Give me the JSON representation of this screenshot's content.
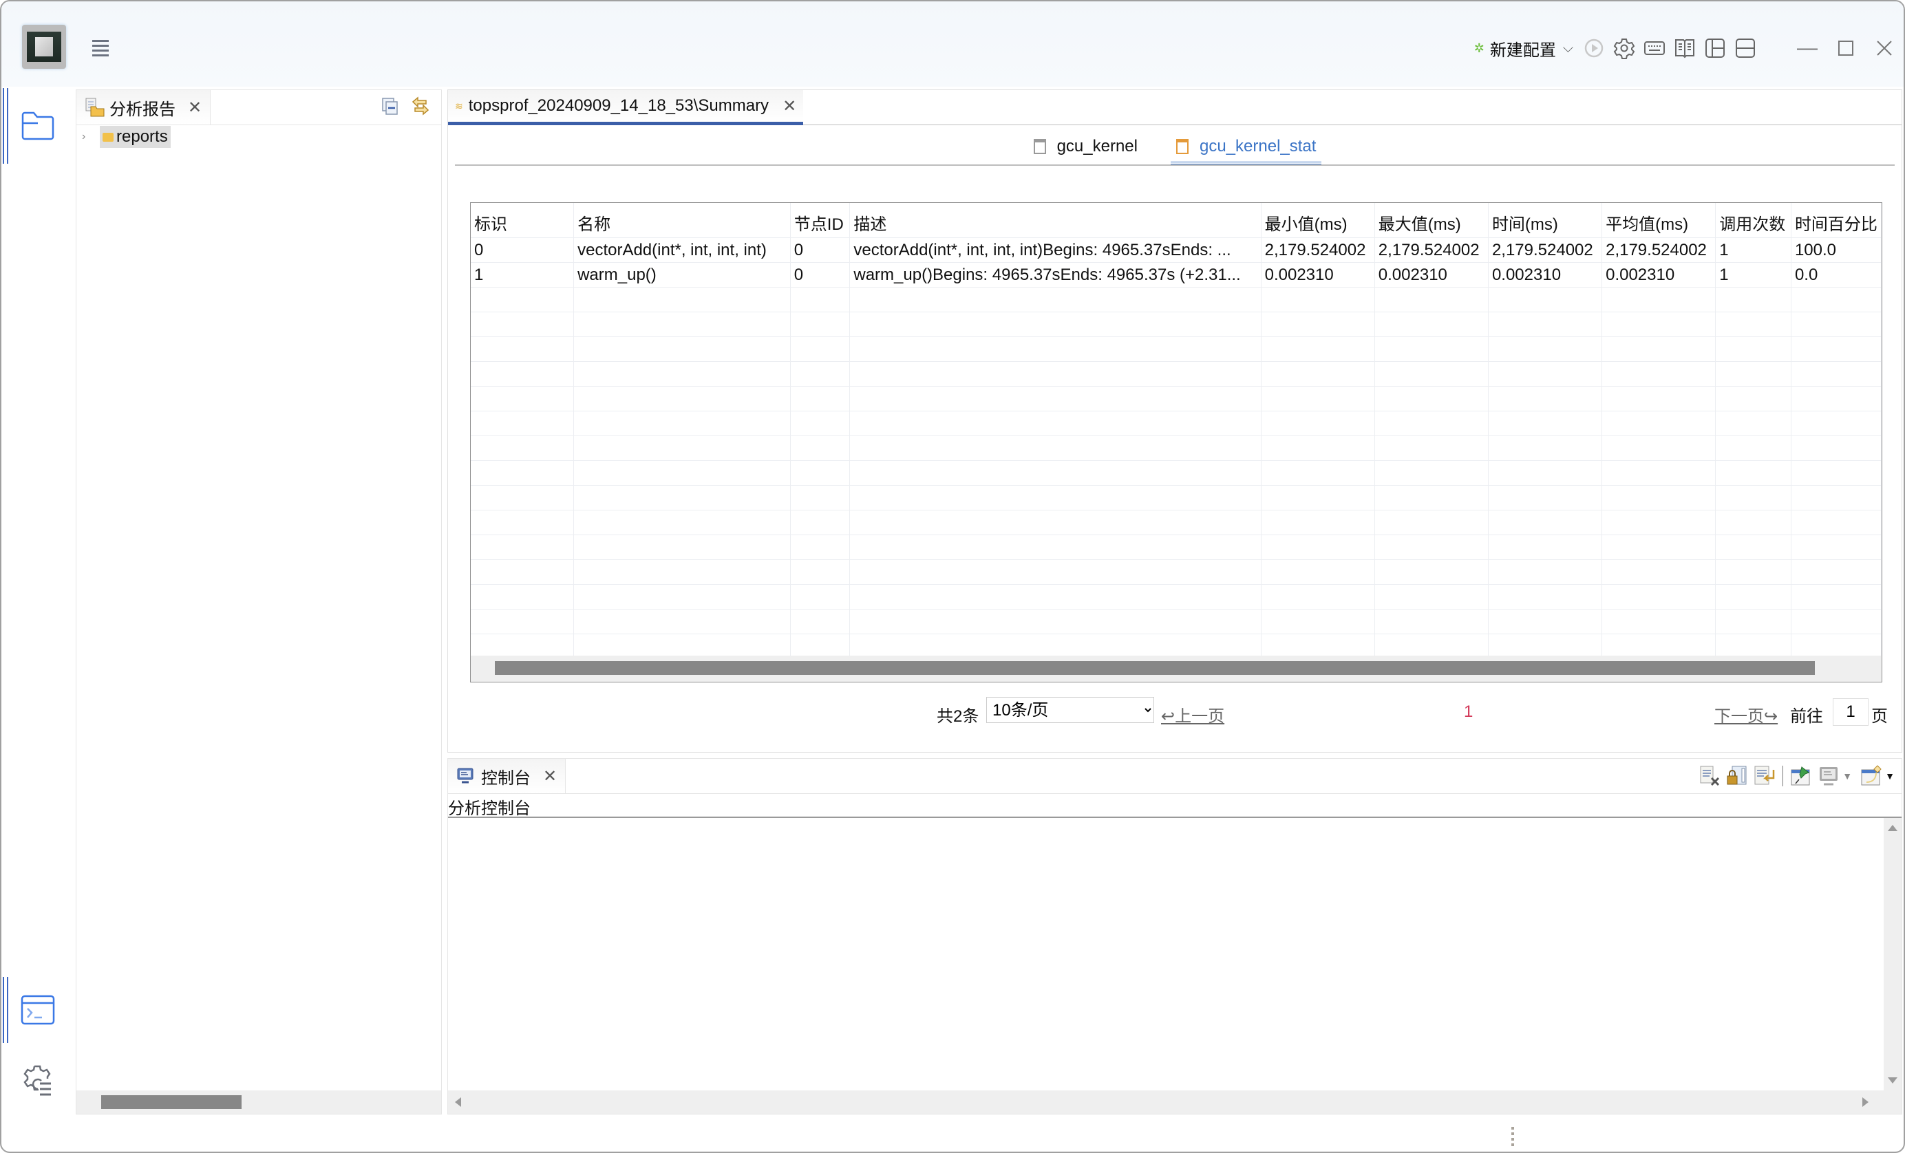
{
  "titlebar": {
    "run_config_label": "新建配置",
    "icons": [
      "run-icon",
      "settings-icon",
      "keyboard-icon",
      "book-icon",
      "layout-left-icon",
      "layout-bottom-icon"
    ],
    "window_controls": [
      "minimize",
      "maximize",
      "close"
    ]
  },
  "activity_bar": {
    "items": [
      {
        "name": "explorer",
        "icon": "folder-icon",
        "active": true
      },
      {
        "name": "terminal",
        "icon": "terminal-icon",
        "active": true
      },
      {
        "name": "settings",
        "icon": "gear-list-icon",
        "active": false
      }
    ]
  },
  "left_panel": {
    "tab_label": "分析报告",
    "tree": [
      {
        "label": "reports",
        "expanded": false
      }
    ]
  },
  "editor": {
    "tab_label": "topsprof_20240909_14_18_53\\Summary",
    "subtabs": [
      {
        "label": "gcu_kernel",
        "active": false
      },
      {
        "label": "gcu_kernel_stat",
        "active": true
      }
    ],
    "table": {
      "columns": [
        "标识",
        "名称",
        "节点ID",
        "描述",
        "最小值(ms)",
        "最大值(ms)",
        "时间(ms)",
        "平均值(ms)",
        "调用次数",
        "时间百分比"
      ],
      "rows": [
        [
          "0",
          "vectorAdd(int*, int, int, int)",
          "0",
          "vectorAdd(int*, int, int, int)Begins: 4965.37sEnds: ...",
          "2,179.524002",
          "2,179.524002",
          "2,179.524002",
          "2,179.524002",
          "1",
          "100.0"
        ],
        [
          "1",
          "warm_up()",
          "0",
          "warm_up()Begins: 4965.37sEnds: 4965.37s (+2.31...",
          "0.002310",
          "0.002310",
          "0.002310",
          "0.002310",
          "1",
          "0.0"
        ]
      ]
    },
    "pager": {
      "total_label": "共2条",
      "page_size": "10条/页",
      "prev_label": "↩上一页",
      "current_page": "1",
      "next_label": "下一页↪",
      "goto_label": "前往",
      "goto_value": "1",
      "page_unit": "页"
    }
  },
  "console": {
    "tab_label": "控制台",
    "title": "分析控制台"
  }
}
